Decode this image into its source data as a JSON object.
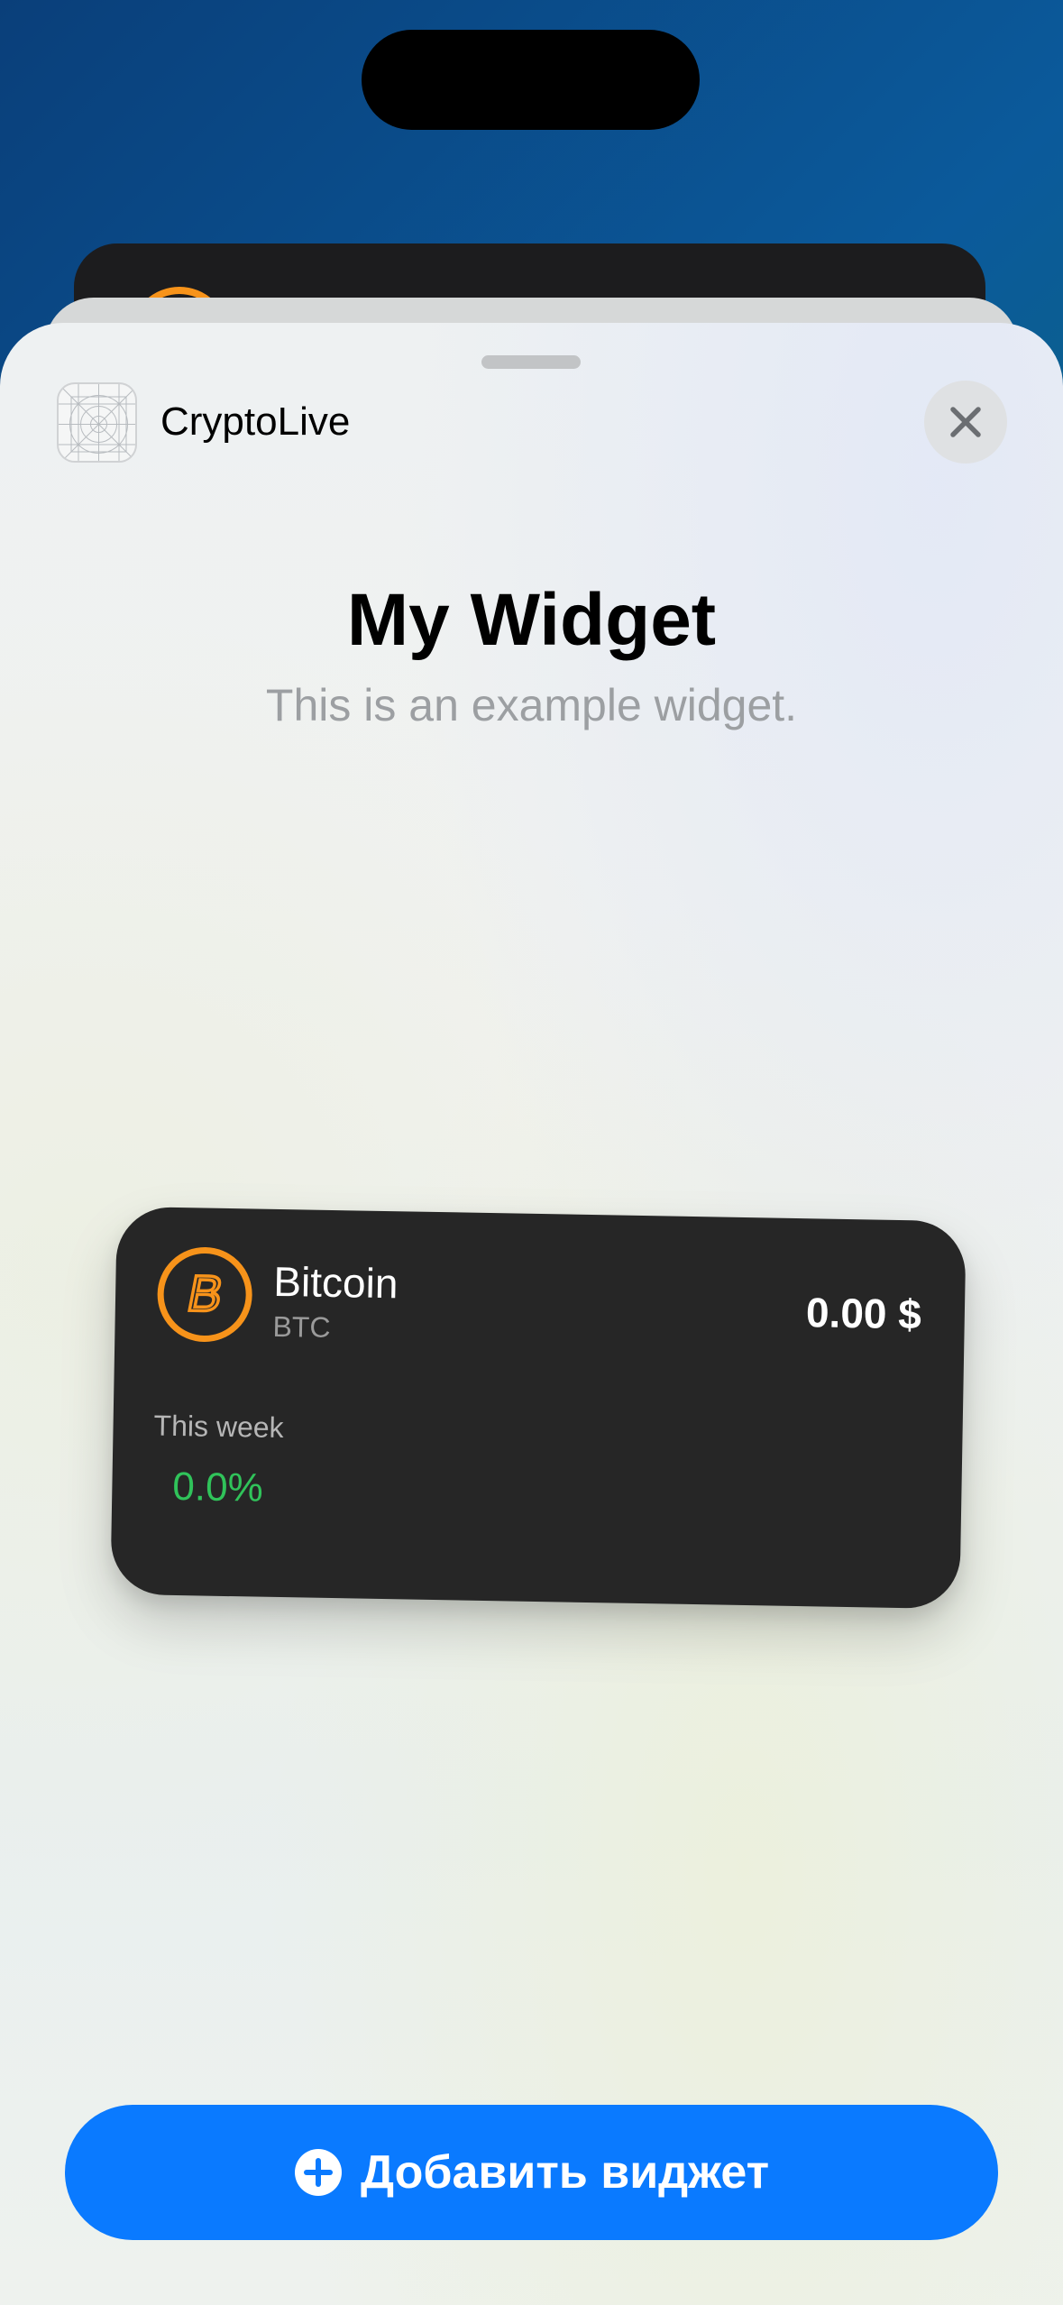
{
  "sheet": {
    "app_name": "CryptoLive",
    "widget_title": "My Widget",
    "widget_subtitle": "This is an example widget.",
    "add_button_label": "Добавить виджет"
  },
  "widget": {
    "coin_name": "Bitcoin",
    "coin_symbol": "BTC",
    "price": "0.00 $",
    "period_label": "This week",
    "change": "0.0%"
  },
  "icons": {
    "close": "close-icon",
    "plus": "plus-circle-icon",
    "coin": "bitcoin-logo-icon",
    "app": "app-placeholder-icon"
  },
  "colors": {
    "accent": "#0a7aff",
    "positive": "#30c35a",
    "bitcoin": "#f7931a",
    "widget_background": "#262626"
  }
}
